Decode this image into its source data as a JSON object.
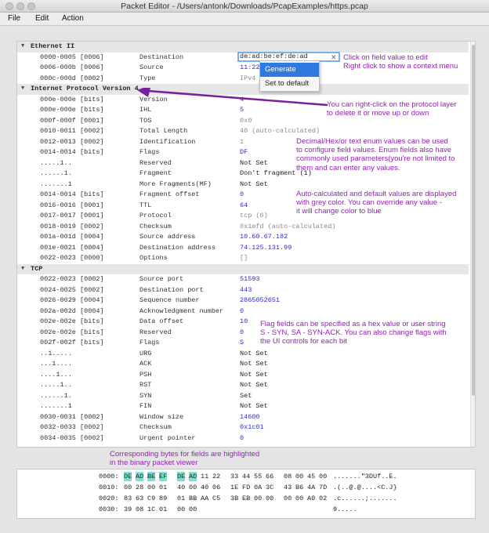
{
  "window": {
    "title": "Packet Editor - /Users/antonk/Downloads/PcapExamples/https.pcap"
  },
  "menu": [
    "File",
    "Edit",
    "Action"
  ],
  "editor": {
    "value": "de:ad:be:ef:de:ad",
    "clear_icon": "close-icon",
    "context_menu": [
      "Generate",
      "Set to default"
    ]
  },
  "sections": [
    {
      "title": "Ethernet II",
      "rows": [
        [
          "0000-0005 [0006]",
          "Destination",
          "",
          "editing"
        ],
        [
          "0006-000b [0006]",
          "Source",
          "11:22",
          "blue"
        ],
        [
          "000c-000d [0002]",
          "Type",
          "IPv4",
          "grey"
        ]
      ]
    },
    {
      "title": "Internet Protocol Version 4",
      "rows": [
        [
          "000e-000e [bits]",
          "Version",
          "4",
          "blue"
        ],
        [
          "000e-000e [bits]",
          "IHL",
          "5",
          "blue"
        ],
        [
          "000f-000f [0001]",
          "TOS",
          "0x0",
          "grey"
        ],
        [
          "0010-0011 [0002]",
          "Total Length",
          "40 (auto-calculated)",
          "grey"
        ],
        [
          "0012-0013 [0002]",
          "Identification",
          "1",
          "grey"
        ],
        [
          "0014-0014 [bits]",
          "Flags",
          "DF",
          "blue"
        ],
        [
          ".....1..",
          "Reserved",
          "Not Set",
          "black"
        ],
        [
          "......1.",
          "Fragment",
          "Don't fragment (1)",
          "black"
        ],
        [
          ".......1",
          "More Fragments(MF)",
          "Not Set",
          "black"
        ],
        [
          "0014-0014 [bits]",
          "Fragment offset",
          "0",
          "blue"
        ],
        [
          "0016-0016 [0001]",
          "TTL",
          "64",
          "blue"
        ],
        [
          "0017-0017 [0001]",
          "Protocol",
          "tcp (6)",
          "grey"
        ],
        [
          "0018-0019 [0002]",
          "Checksum",
          "0x1efd (auto-calculated)",
          "grey"
        ],
        [
          "001a-001d [0004]",
          "Source address",
          "10.60.67.182",
          "blue"
        ],
        [
          "001e-0021 [0004]",
          "Destination address",
          "74.125.131.99",
          "blue"
        ],
        [
          "0022-0023 [0000]",
          "Options",
          "[]",
          "grey"
        ]
      ]
    },
    {
      "title": "TCP",
      "rows": [
        [
          "0022-0023 [0002]",
          "Source port",
          "51593",
          "blue"
        ],
        [
          "0024-0025 [0002]",
          "Destination port",
          "443",
          "blue"
        ],
        [
          "0026-0029 [0004]",
          "Sequence number",
          "2865052651",
          "blue"
        ],
        [
          "002a-002d [0004]",
          "Acknowledgment number",
          "0",
          "blue"
        ],
        [
          "002e-002e [bits]",
          "Data offset",
          "10",
          "blue"
        ],
        [
          "002e-002e [bits]",
          "Reserved",
          "0",
          "blue"
        ],
        [
          "002f-002f [bits]",
          "Flags",
          "S",
          "blue"
        ],
        [
          "..1.....",
          "URG",
          "Not Set",
          "black"
        ],
        [
          "...1....",
          "ACK",
          "Not Set",
          "black"
        ],
        [
          "....1...",
          "PSH",
          "Not Set",
          "black"
        ],
        [
          ".....1..",
          "RST",
          "Not Set",
          "black"
        ],
        [
          "......1.",
          "SYN",
          "Set",
          "black"
        ],
        [
          ".......1",
          "FIN",
          "Not Set",
          "black"
        ],
        [
          "0030-0031 [0002]",
          "Window size",
          "14600",
          "blue"
        ],
        [
          "0032-0033 [0002]",
          "Checksum",
          "0x1c01",
          "blue"
        ],
        [
          "0034-0035 [0002]",
          "Urgent pointer",
          "0",
          "blue"
        ]
      ]
    }
  ],
  "annotations": [
    "Click on field value to edit\nRight click to show a context menu",
    "You can right-click on the protocol layer\nto delete it or move up or down",
    "Decimal/Hex/or text enum values can be used\nto configure field values. Enum fields also have\ncommonly used parameters(you're not limited to\nthem and can enter any values.",
    "Auto-calculated and default values are displayed\nwith grey color. You can override any value -\nit will change color to blue",
    "Flag fields can be specified as a hex value or user string\nS - SYN, SA - SYN-ACK. You can also change flags with\nthe UI controls for each bit",
    "Corresponding bytes for fields are highlighted\nin the binary packet viewer"
  ],
  "hex": [
    {
      "offset": "0000:",
      "bytes": [
        "DE",
        "AD",
        "BE",
        "EF",
        "DE",
        "AD",
        "11",
        "22",
        "33",
        "44",
        "55",
        "66",
        "08",
        "00",
        "45",
        "00"
      ],
      "ascii": ".......\"3DUf..E.",
      "highlight": [
        0,
        1,
        2,
        3,
        4,
        5
      ]
    },
    {
      "offset": "0010:",
      "bytes": [
        "00",
        "28",
        "00",
        "01",
        "40",
        "00",
        "40",
        "06",
        "1E",
        "FD",
        "0A",
        "3C",
        "43",
        "B6",
        "4A",
        "7D"
      ],
      "ascii": ".(..@.@....<C.J}",
      "highlight": []
    },
    {
      "offset": "0020:",
      "bytes": [
        "83",
        "63",
        "C9",
        "89",
        "01",
        "BB",
        "AA",
        "C5",
        "3B",
        "EB",
        "00",
        "00",
        "00",
        "00",
        "A0",
        "02"
      ],
      "ascii": ".c......;.......",
      "highlight": []
    },
    {
      "offset": "0030:",
      "bytes": [
        "39",
        "08",
        "1C",
        "01",
        "00",
        "00"
      ],
      "ascii": "9.....",
      "highlight": []
    }
  ],
  "colors": {
    "annotation": "#9422b5",
    "value_blue": "#2a2ad8",
    "value_grey": "#8a8a8a",
    "highlight": "#7ee2cf",
    "menu_selected": "#2f7ae0"
  }
}
